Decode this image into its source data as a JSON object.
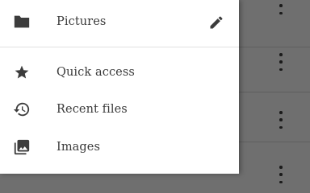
{
  "drawer": {
    "header": {
      "folder_name": "Pictures",
      "folder_icon": "folder-icon",
      "edit_icon": "pencil-icon"
    },
    "items": [
      {
        "label": "Quick access",
        "icon": "star-icon"
      },
      {
        "label": "Recent files",
        "icon": "history-icon"
      },
      {
        "label": "Images",
        "icon": "image-icon"
      }
    ]
  },
  "background": {
    "overflow_icon": "more-vert-icon",
    "scrim_color": "#6f6f6f"
  }
}
